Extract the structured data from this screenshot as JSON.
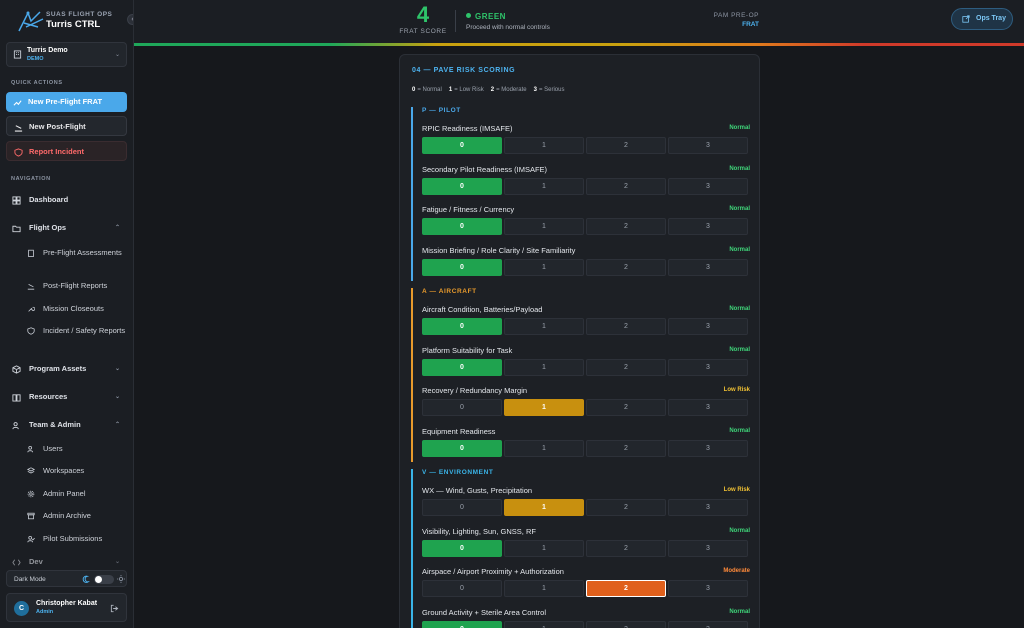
{
  "brand": {
    "kicker": "SUAS FLIGHT OPS",
    "name": "Turris CTRL"
  },
  "workspace": {
    "name": "Turris Demo",
    "sub": "DEMO"
  },
  "sidebar": {
    "quick_actions_title": "QUICK ACTIONS",
    "quick_actions": [
      "New Pre-Flight FRAT",
      "New Post-Flight",
      "Report Incident"
    ],
    "navigation_title": "NAVIGATION",
    "nav": {
      "dashboard": "Dashboard",
      "flight_ops": "Flight Ops",
      "pre_flight": "Pre-Flight Assessments",
      "post_flight": "Post-Flight Reports",
      "closeouts": "Mission Closeouts",
      "incident": "Incident / Safety Reports",
      "program_assets": "Program Assets",
      "resources": "Resources",
      "team_admin": "Team & Admin",
      "users": "Users",
      "workspaces": "Workspaces",
      "admin_panel": "Admin Panel",
      "admin_archive": "Admin Archive",
      "pilot_submissions": "Pilot Submissions",
      "dev": "Dev"
    },
    "dark_mode": "Dark Mode",
    "user": {
      "initial": "C",
      "name": "Christopher Kabat",
      "role": "Admin"
    }
  },
  "header": {
    "score": "4",
    "score_label": "FRAT SCORE",
    "status": "GREEN",
    "status_sub": "Proceed with normal controls",
    "pam_label": "PAM PRE-OP",
    "pam_value": "FRAT",
    "tray_label": "Ops Tray"
  },
  "colors": {
    "green": "#1fa34f",
    "yellow": "#c8900f",
    "orange": "#e0601c",
    "pilot": "#4aa8ea",
    "aircraft": "#e89a2c",
    "environment": "#3ab4e8"
  },
  "scoring": {
    "title": "04 — PAVE RISK SCORING",
    "legend": [
      {
        "num": "0",
        "label": "= Normal"
      },
      {
        "num": "1",
        "label": "= Low Risk"
      },
      {
        "num": "2",
        "label": "= Moderate"
      },
      {
        "num": "3",
        "label": "= Serious"
      }
    ],
    "options": [
      "0",
      "1",
      "2",
      "3"
    ],
    "groups": [
      {
        "title": "P — PILOT",
        "items": [
          {
            "label": "RPIC Readiness (IMSAFE)",
            "status": "Normal",
            "selected": 0
          },
          {
            "label": "Secondary Pilot Readiness (IMSAFE)",
            "status": "Normal",
            "selected": 0
          },
          {
            "label": "Fatigue / Fitness / Currency",
            "status": "Normal",
            "selected": 0
          },
          {
            "label": "Mission Briefing / Role Clarity / Site Familiarity",
            "status": "Normal",
            "selected": 0
          }
        ]
      },
      {
        "title": "A — AIRCRAFT",
        "items": [
          {
            "label": "Aircraft Condition, Batteries/Payload",
            "status": "Normal",
            "selected": 0
          },
          {
            "label": "Platform Suitability for Task",
            "status": "Normal",
            "selected": 0
          },
          {
            "label": "Recovery / Redundancy Margin",
            "status": "Low Risk",
            "selected": 1
          },
          {
            "label": "Equipment Readiness",
            "status": "Normal",
            "selected": 0
          }
        ]
      },
      {
        "title": "V — ENVIRONMENT",
        "items": [
          {
            "label": "WX — Wind, Gusts, Precipitation",
            "status": "Low Risk",
            "selected": 1
          },
          {
            "label": "Visibility, Lighting, Sun, GNSS, RF",
            "status": "Normal",
            "selected": 0
          },
          {
            "label": "Airspace / Airport Proximity + Authorization",
            "status": "Moderate",
            "selected": 2
          },
          {
            "label": "Ground Activity + Sterile Area Control",
            "status": "Normal",
            "selected": 0
          }
        ]
      }
    ]
  }
}
